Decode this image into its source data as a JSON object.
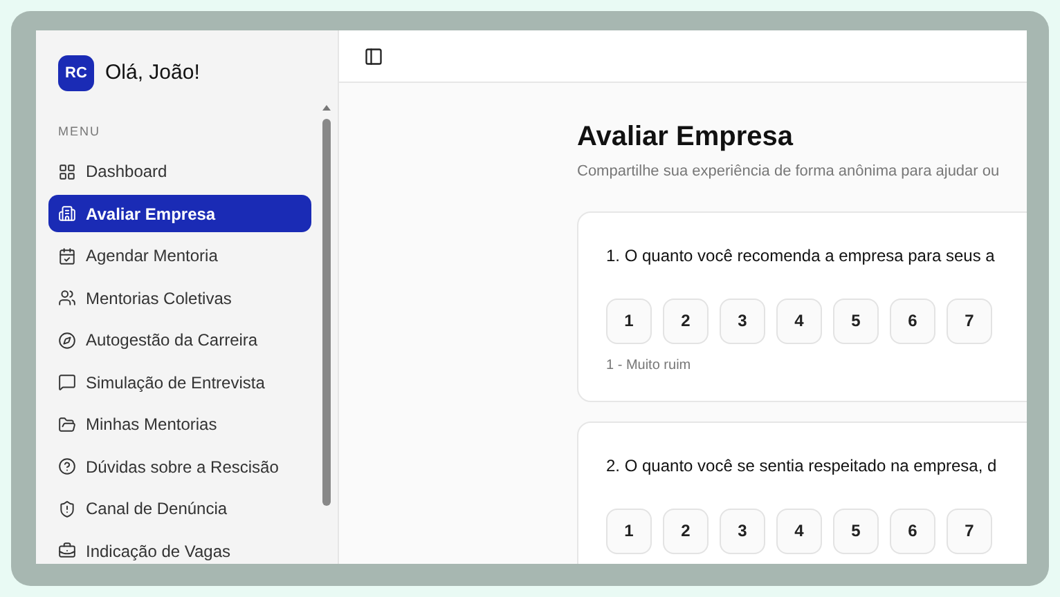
{
  "user": {
    "initials": "RC",
    "greeting": "Olá, João!"
  },
  "sidebar": {
    "section": "MENU",
    "items": [
      {
        "label": "Dashboard",
        "selected": false
      },
      {
        "label": "Avaliar Empresa",
        "selected": true
      },
      {
        "label": "Agendar Mentoria",
        "selected": false
      },
      {
        "label": "Mentorias Coletivas",
        "selected": false
      },
      {
        "label": "Autogestão da Carreira",
        "selected": false
      },
      {
        "label": "Simulação de Entrevista",
        "selected": false
      },
      {
        "label": "Minhas Mentorias",
        "selected": false
      },
      {
        "label": "Dúvidas sobre a Rescisão",
        "selected": false
      },
      {
        "label": "Canal de Denúncia",
        "selected": false
      },
      {
        "label": "Indicação de Vagas",
        "selected": false
      }
    ]
  },
  "page": {
    "title": "Avaliar Empresa",
    "subtitle": "Compartilhe sua experiência de forma anônima para ajudar ou",
    "questions": [
      {
        "text": "1. O quanto você recomenda a empresa para seus a",
        "options": [
          "1",
          "2",
          "3",
          "4",
          "5",
          "6",
          "7"
        ],
        "hint": "1 - Muito ruim"
      },
      {
        "text": "2. O quanto você se sentia respeitado na empresa, d",
        "options": [
          "1",
          "2",
          "3",
          "4",
          "5",
          "6",
          "7"
        ]
      }
    ]
  }
}
